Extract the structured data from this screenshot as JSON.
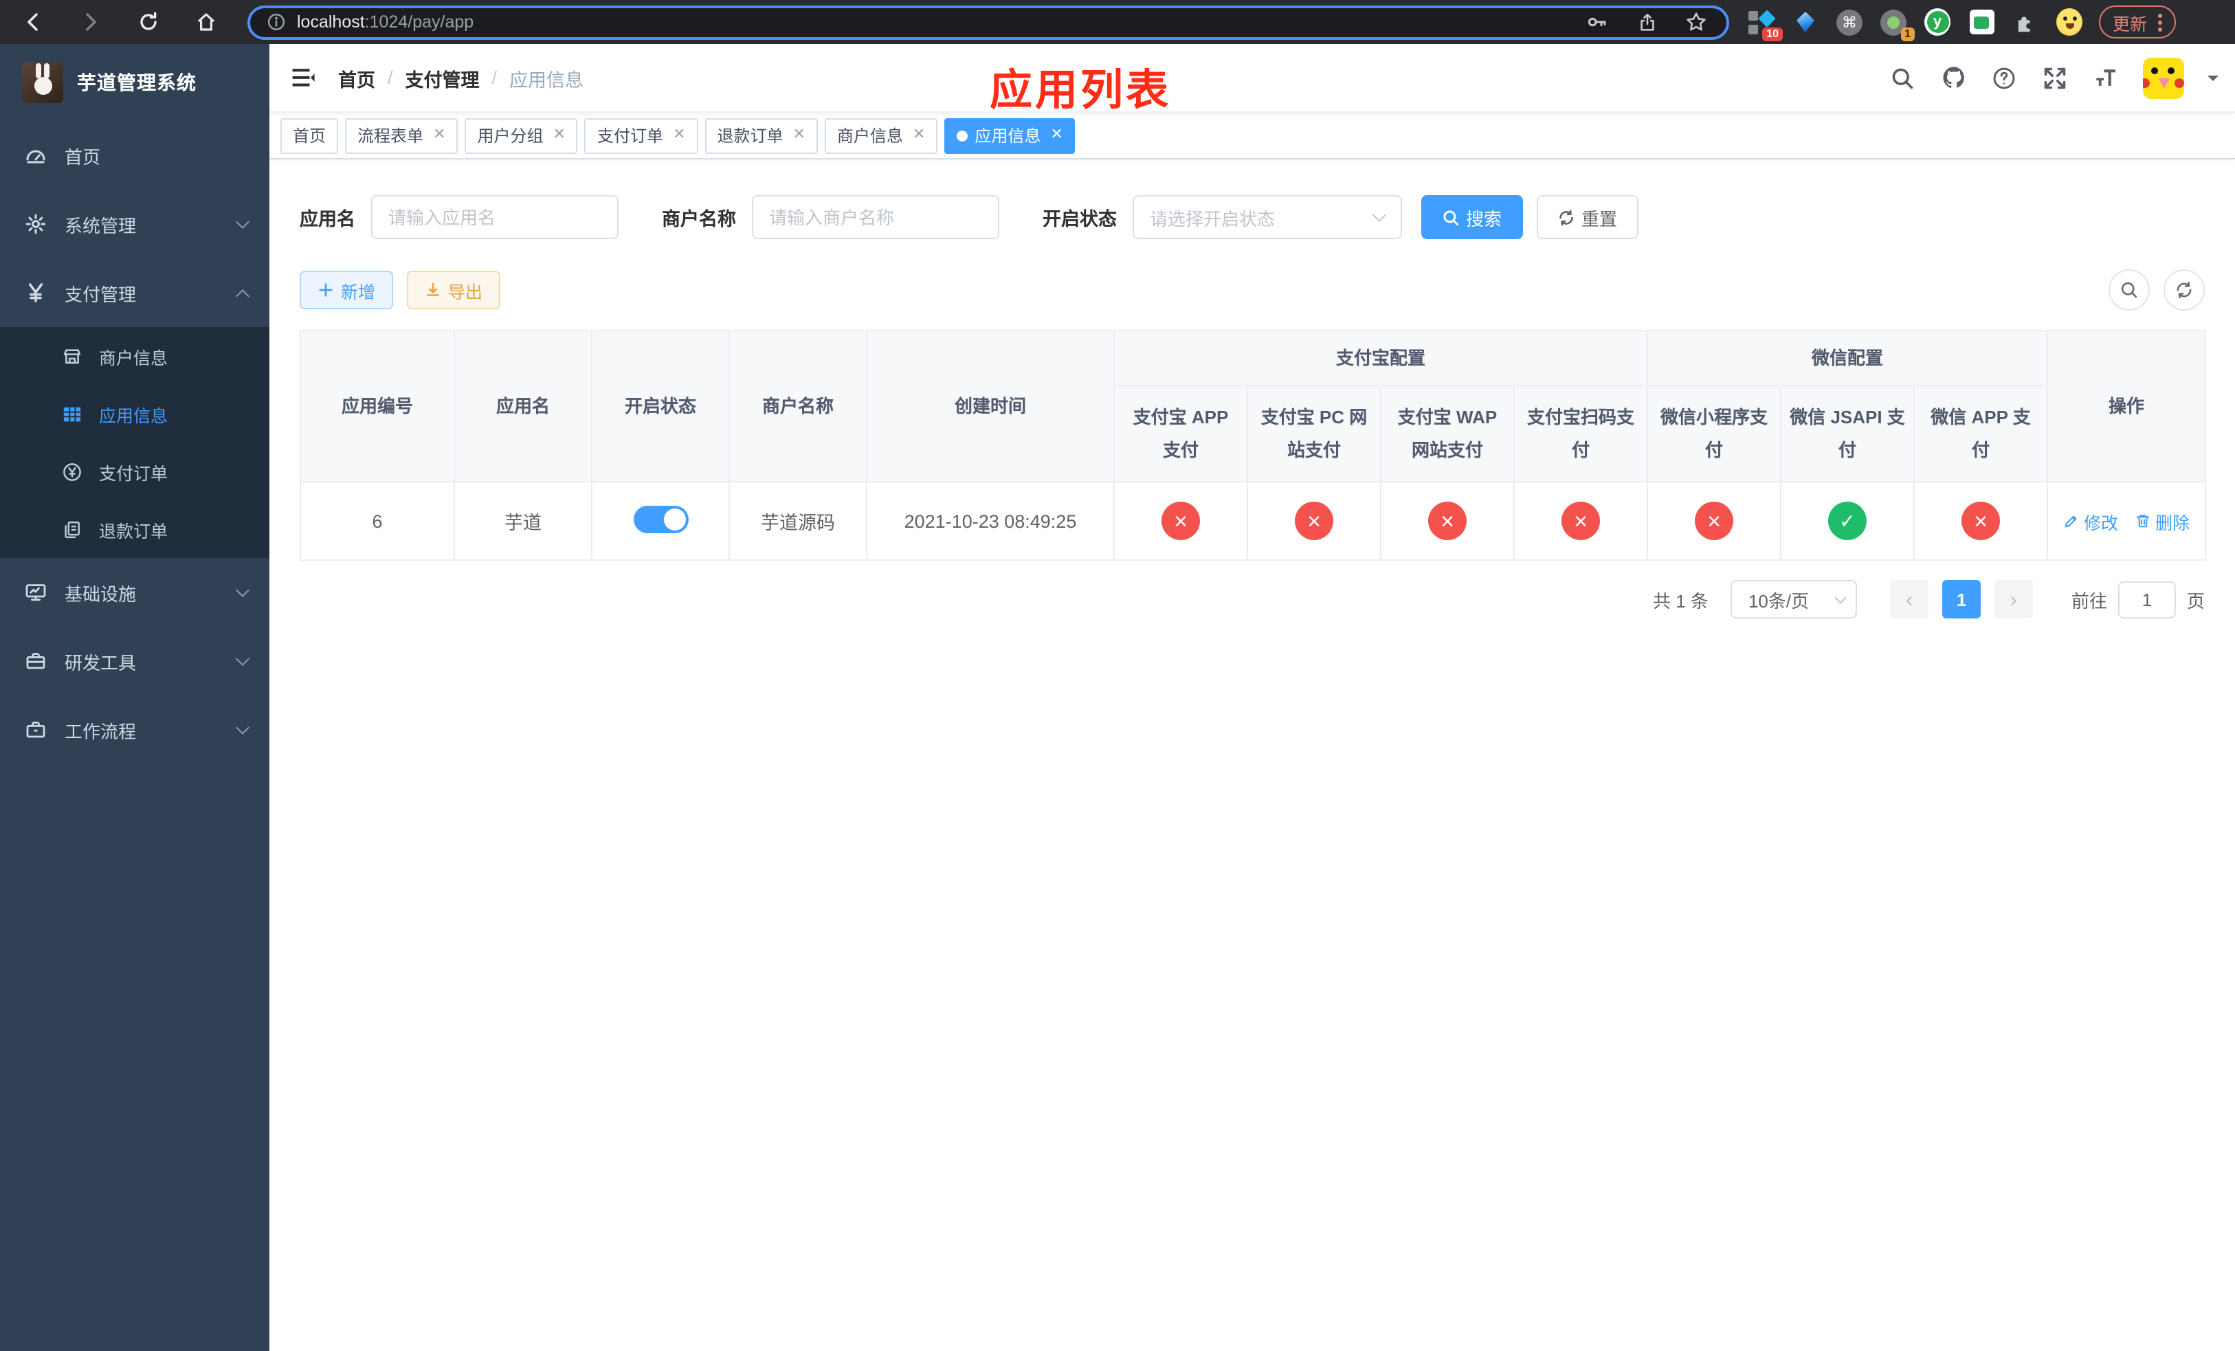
{
  "colors": {
    "accent": "#409eff",
    "danger": "#f4524d",
    "success": "#1fbc69",
    "annotation": "#ff2d16",
    "sidebar_bg": "#304156",
    "submenu_bg": "#1f2d3d"
  },
  "browser": {
    "url_host": "localhost",
    "url_path": ":1024/pay/app",
    "ext_badge_a": "10",
    "ext_badge_b": "1",
    "ext_y_letter": "y",
    "update_label": "更新"
  },
  "sidebar": {
    "title": "芋道管理系统",
    "items": [
      {
        "label": "首页"
      },
      {
        "label": "系统管理"
      },
      {
        "label": "支付管理"
      },
      {
        "label": "商户信息"
      },
      {
        "label": "应用信息"
      },
      {
        "label": "支付订单"
      },
      {
        "label": "退款订单"
      },
      {
        "label": "基础设施"
      },
      {
        "label": "研发工具"
      },
      {
        "label": "工作流程"
      }
    ]
  },
  "header": {
    "breadcrumb": [
      "首页",
      "支付管理",
      "应用信息"
    ],
    "annotation": "应用列表"
  },
  "tabs": [
    {
      "label": "首页"
    },
    {
      "label": "流程表单"
    },
    {
      "label": "用户分组"
    },
    {
      "label": "支付订单"
    },
    {
      "label": "退款订单"
    },
    {
      "label": "商户信息"
    },
    {
      "label": "应用信息"
    }
  ],
  "filters": {
    "app_name_label": "应用名",
    "app_name_placeholder": "请输入应用名",
    "merchant_label": "商户名称",
    "merchant_placeholder": "请输入商户名称",
    "status_label": "开启状态",
    "status_placeholder": "请选择开启状态",
    "search_label": "搜索",
    "reset_label": "重置"
  },
  "toolbar": {
    "add_label": "新增",
    "export_label": "导出"
  },
  "table": {
    "headers": {
      "app_id": "应用编号",
      "app_name": "应用名",
      "status": "开启状态",
      "merchant": "商户名称",
      "created": "创建时间",
      "alipay_group": "支付宝配置",
      "wechat_group": "微信配置",
      "ops": "操作",
      "sub": [
        "支付宝 APP 支付",
        "支付宝 PC 网站支付",
        "支付宝 WAP 网站支付",
        "支付宝扫码支付",
        "微信小程序支付",
        "微信 JSAPI 支付",
        "微信 APP 支付"
      ]
    },
    "rows": [
      {
        "app_id": "6",
        "app_name": "芋道",
        "enabled": "true",
        "merchant": "芋道源码",
        "created": "2021-10-23 08:49:25",
        "pay": [
          "cross",
          "cross",
          "cross",
          "cross",
          "cross",
          "check",
          "cross"
        ],
        "edit_label": "修改",
        "delete_label": "删除"
      }
    ]
  },
  "pagination": {
    "total": "共 1 条",
    "page_size": "10条/页",
    "current_page": "1",
    "goto_label": "前往",
    "goto_value": "1",
    "page_unit": "页"
  }
}
